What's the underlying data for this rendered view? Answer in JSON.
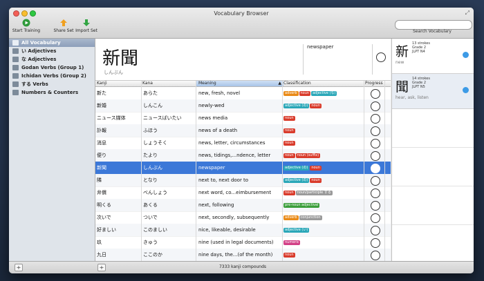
{
  "window": {
    "title": "Vocabulary Browser"
  },
  "toolbar": {
    "start": "Start Training",
    "share": "Share Set",
    "import": "Import Set"
  },
  "search": {
    "placeholder": "",
    "label": "Search Vocabulary"
  },
  "sidebar": {
    "items": [
      {
        "label": "All Vocabulary"
      },
      {
        "label": "い Adjectives"
      },
      {
        "label": "な Adjectives"
      },
      {
        "label": "Godan Verbs (Group 1)"
      },
      {
        "label": "Ichidan Verbs (Group 2)"
      },
      {
        "label": "する Verbs"
      },
      {
        "label": "Numbers & Counters"
      }
    ]
  },
  "header": {
    "kanji": "新聞",
    "reading": "しんぶん",
    "meaning": "newspaper"
  },
  "columns": {
    "kanji": "Kanji",
    "kana": "Kana",
    "meaning": "Meaning",
    "classification": "Classification",
    "progress": "Progress"
  },
  "rows": [
    {
      "kanji": "新た",
      "kana": "あらた",
      "meaning": "new, fresh, novel",
      "tags": [
        {
          "t": "adverb",
          "c": "orange"
        },
        {
          "t": "noun",
          "c": "red"
        },
        {
          "t": "adjective (な)",
          "c": "teal"
        }
      ]
    },
    {
      "kanji": "新婚",
      "kana": "しんこん",
      "meaning": "newly-wed",
      "tags": [
        {
          "t": "adjective (の)",
          "c": "teal"
        },
        {
          "t": "noun",
          "c": "red"
        }
      ]
    },
    {
      "kanji": "ニュース媒体",
      "kana": "ニュースばいたい",
      "meaning": "news media",
      "tags": [
        {
          "t": "noun",
          "c": "red"
        }
      ]
    },
    {
      "kanji": "訃報",
      "kana": "ふほう",
      "meaning": "news of a death",
      "tags": [
        {
          "t": "noun",
          "c": "red"
        }
      ]
    },
    {
      "kanji": "消息",
      "kana": "しょうそく",
      "meaning": "news, letter, circumstances",
      "tags": [
        {
          "t": "noun",
          "c": "red"
        }
      ]
    },
    {
      "kanji": "便り",
      "kana": "たより",
      "meaning": "news, tidings,...ndence, letter",
      "tags": [
        {
          "t": "noun",
          "c": "red"
        },
        {
          "t": "noun (suffix)",
          "c": "red"
        }
      ]
    },
    {
      "kanji": "新聞",
      "kana": "しんぶん",
      "meaning": "newspaper",
      "tags": [
        {
          "t": "adjective (の)",
          "c": "teal"
        },
        {
          "t": "noun",
          "c": "red"
        }
      ],
      "selected": true
    },
    {
      "kanji": "隣",
      "kana": "となり",
      "meaning": "next to, next door to",
      "tags": [
        {
          "t": "adjective (の)",
          "c": "teal"
        },
        {
          "t": "noun",
          "c": "red"
        }
      ]
    },
    {
      "kanji": "弁償",
      "kana": "べんしょう",
      "meaning": "next word, co...eimbursement",
      "tags": [
        {
          "t": "noun",
          "c": "red"
        },
        {
          "t": "noun/participle する",
          "c": "gray"
        }
      ]
    },
    {
      "kanji": "明くる",
      "kana": "あくる",
      "meaning": "next, following",
      "tags": [
        {
          "t": "pre-noun adjectival",
          "c": "green"
        }
      ]
    },
    {
      "kanji": "次いで",
      "kana": "ついで",
      "meaning": "next, secondly, subsequently",
      "tags": [
        {
          "t": "adverb",
          "c": "orange"
        },
        {
          "t": "conjunction",
          "c": "gray"
        }
      ]
    },
    {
      "kanji": "好ましい",
      "kana": "このましい",
      "meaning": "nice, likeable, desirable",
      "tags": [
        {
          "t": "adjective (い)",
          "c": "teal"
        }
      ]
    },
    {
      "kanji": "玖",
      "kana": "きゅう",
      "meaning": "nine (used in legal documents)",
      "tags": [
        {
          "t": "numeric",
          "c": "pink"
        }
      ]
    },
    {
      "kanji": "九日",
      "kana": "ここのか",
      "meaning": "nine days, the...(of the month)",
      "tags": [
        {
          "t": "noun",
          "c": "red"
        }
      ]
    }
  ],
  "kanji_cards": [
    {
      "kanji": "新",
      "strokes": "13 strokes",
      "grade": "Grade 2",
      "jlpt": "JLPT N4",
      "meaning": "new"
    },
    {
      "kanji": "聞",
      "strokes": "14 strokes",
      "grade": "Grade 2",
      "jlpt": "JLPT N5",
      "meaning": "hear, ask, listen"
    }
  ],
  "status": {
    "count": "7333 kanji compounds"
  }
}
